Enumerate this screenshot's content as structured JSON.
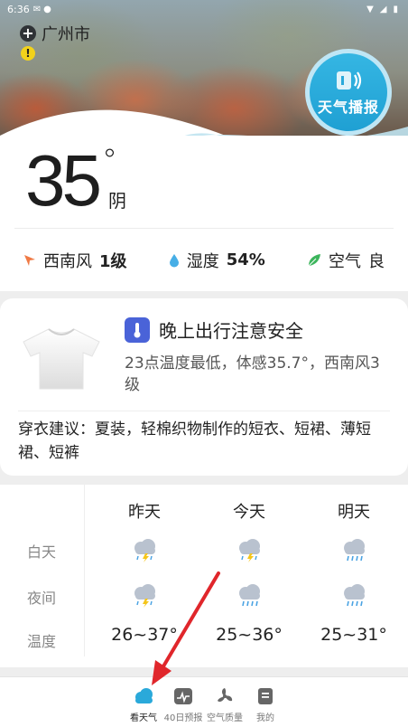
{
  "status_bar": {
    "time": "6:36"
  },
  "location": {
    "city": "广州市"
  },
  "broadcast": {
    "label": "天气播报"
  },
  "current": {
    "temperature": "35",
    "degree_symbol": "°",
    "condition": "阴"
  },
  "metrics": [
    {
      "icon": "wind-arrow-icon",
      "label": "西南风",
      "value": "1级"
    },
    {
      "icon": "humidity-drop-icon",
      "label": "湿度",
      "value": "54%"
    },
    {
      "icon": "leaf-icon",
      "label": "空气",
      "value": "良"
    }
  ],
  "advice": {
    "title": "晚上出行注意安全",
    "description": "23点温度最低，体感35.7°，西南风3级",
    "clothing": "穿衣建议：夏装，轻棉织物制作的短衣、短裙、薄短裙、短裤"
  },
  "forecast": {
    "row_labels": {
      "day": "白天",
      "night": "夜间",
      "temp": "温度"
    },
    "days": [
      {
        "label": "昨天",
        "day_icon": "thunder-rain-icon",
        "night_icon": "thunder-rain-icon",
        "temp": "26~37°"
      },
      {
        "label": "今天",
        "day_icon": "thunder-rain-icon",
        "night_icon": "rain-icon",
        "temp": "25~36°"
      },
      {
        "label": "明天",
        "day_icon": "rain-icon",
        "night_icon": "rain-icon",
        "temp": "25~31°"
      }
    ]
  },
  "nav": [
    {
      "label": "看天气",
      "icon": "cloud-icon",
      "active": true
    },
    {
      "label": "40日预报",
      "icon": "chart-icon",
      "active": false
    },
    {
      "label": "空气质量",
      "icon": "fan-icon",
      "active": false
    },
    {
      "label": "我的",
      "icon": "profile-icon",
      "active": false
    }
  ],
  "colors": {
    "accent": "#22a5d8",
    "arrow": "#e0262b",
    "thermometer": "#4a63d8"
  }
}
